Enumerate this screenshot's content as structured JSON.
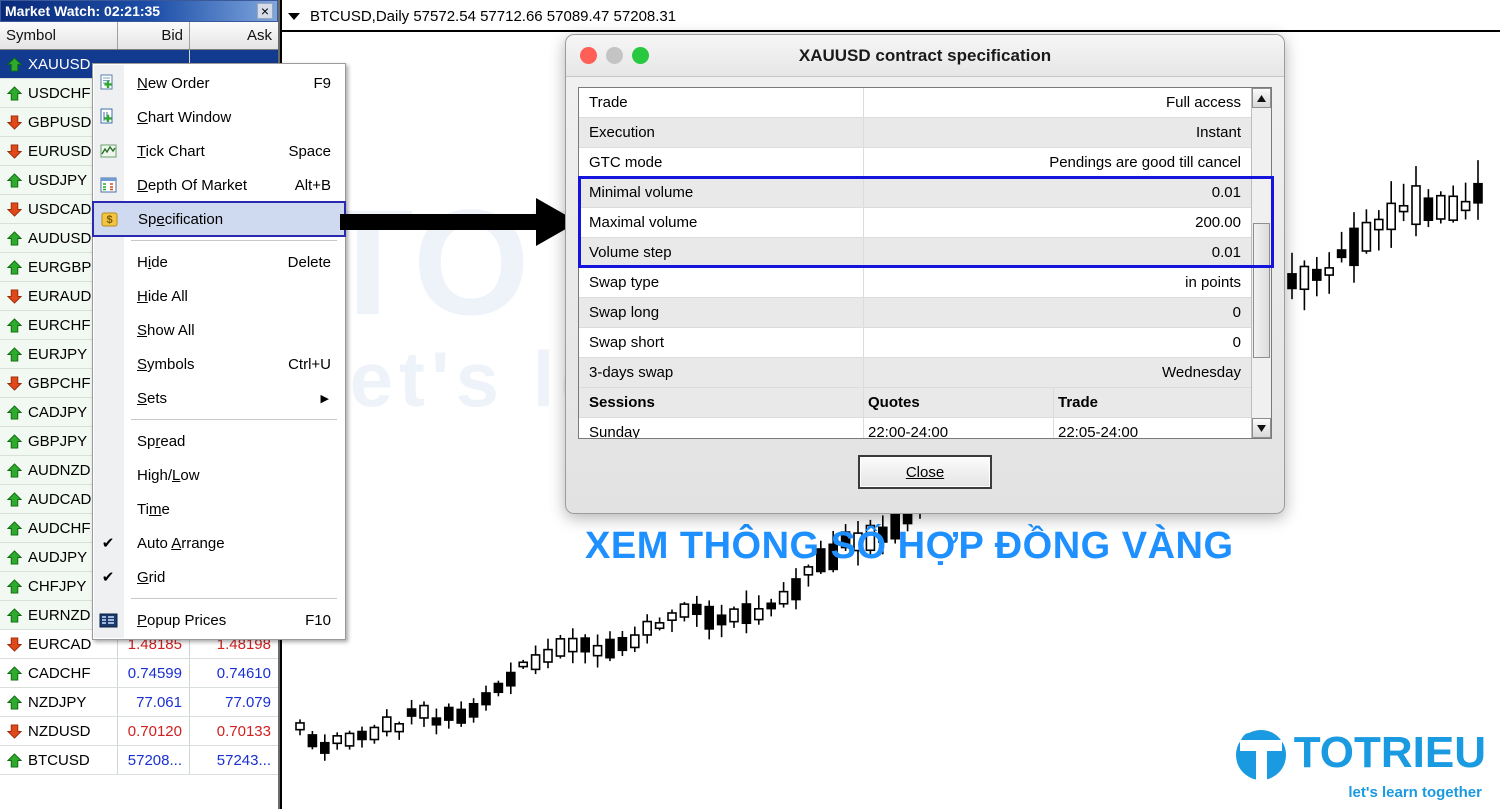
{
  "chart": {
    "symbol_line": "BTCUSD,Daily  57572.54 57712.66 57089.47 57208.31",
    "dropdown_icon": "caret-down-icon",
    "watermark_line1": "TOTRIEU",
    "watermark_line2": "let's learn together"
  },
  "market_watch": {
    "title": "Market Watch: 02:21:35",
    "close_label": "×",
    "columns": {
      "symbol": "Symbol",
      "bid": "Bid",
      "ask": "Ask"
    },
    "rows": [
      {
        "symbol": "XAUUSD",
        "dir": "up",
        "bid": "",
        "ask": "",
        "selected": true
      },
      {
        "symbol": "USDCHF",
        "dir": "up",
        "bid": "",
        "ask": ""
      },
      {
        "symbol": "GBPUSD",
        "dir": "down",
        "bid": "",
        "ask": ""
      },
      {
        "symbol": "EURUSD",
        "dir": "down",
        "bid": "",
        "ask": ""
      },
      {
        "symbol": "USDJPY",
        "dir": "up",
        "bid": "",
        "ask": ""
      },
      {
        "symbol": "USDCAD",
        "dir": "down",
        "bid": "",
        "ask": ""
      },
      {
        "symbol": "AUDUSD",
        "dir": "up",
        "bid": "",
        "ask": ""
      },
      {
        "symbol": "EURGBP",
        "dir": "up",
        "bid": "",
        "ask": ""
      },
      {
        "symbol": "EURAUD",
        "dir": "down",
        "bid": "",
        "ask": ""
      },
      {
        "symbol": "EURCHF",
        "dir": "up",
        "bid": "",
        "ask": ""
      },
      {
        "symbol": "EURJPY",
        "dir": "up",
        "bid": "",
        "ask": ""
      },
      {
        "symbol": "GBPCHF",
        "dir": "down",
        "bid": "",
        "ask": ""
      },
      {
        "symbol": "CADJPY",
        "dir": "up",
        "bid": "",
        "ask": ""
      },
      {
        "symbol": "GBPJPY",
        "dir": "up",
        "bid": "",
        "ask": ""
      },
      {
        "symbol": "AUDNZD",
        "dir": "up",
        "bid": "",
        "ask": ""
      },
      {
        "symbol": "AUDCAD",
        "dir": "up",
        "bid": "",
        "ask": ""
      },
      {
        "symbol": "AUDCHF",
        "dir": "up",
        "bid": "",
        "ask": ""
      },
      {
        "symbol": "AUDJPY",
        "dir": "up",
        "bid": "",
        "ask": ""
      },
      {
        "symbol": "CHFJPY",
        "dir": "up",
        "bid": "",
        "ask": ""
      },
      {
        "symbol": "EURNZD",
        "dir": "up",
        "bid": "",
        "ask": ""
      },
      {
        "symbol": "EURCAD",
        "dir": "down",
        "bid": "1.48185",
        "ask": "1.48198",
        "color": "down"
      },
      {
        "symbol": "CADCHF",
        "dir": "up",
        "bid": "0.74599",
        "ask": "0.74610",
        "color": "up"
      },
      {
        "symbol": "NZDJPY",
        "dir": "up",
        "bid": "77.061",
        "ask": "77.079",
        "color": "up"
      },
      {
        "symbol": "NZDUSD",
        "dir": "down",
        "bid": "0.70120",
        "ask": "0.70133",
        "color": "down"
      },
      {
        "symbol": "BTCUSD",
        "dir": "up",
        "bid": "57208...",
        "ask": "57243...",
        "color": "up"
      }
    ]
  },
  "context_menu": {
    "items": [
      {
        "label": "New Order",
        "accel": "F9",
        "icon": "new-order-icon",
        "type": "item"
      },
      {
        "label": "Chart Window",
        "accel": "",
        "icon": "chart-window-icon",
        "type": "item"
      },
      {
        "label": "Tick Chart",
        "accel": "Space",
        "icon": "tick-chart-icon",
        "type": "item"
      },
      {
        "label": "Depth Of Market",
        "accel": "Alt+B",
        "icon": "depth-market-icon",
        "type": "item"
      },
      {
        "label": "Specification",
        "accel": "",
        "icon": "specification-icon",
        "type": "item",
        "highlighted": true
      },
      {
        "type": "separator"
      },
      {
        "label": "Hide",
        "accel": "Delete",
        "type": "item"
      },
      {
        "label": "Hide All",
        "accel": "",
        "type": "item"
      },
      {
        "label": "Show All",
        "accel": "",
        "type": "item"
      },
      {
        "label": "Symbols",
        "accel": "Ctrl+U",
        "type": "item"
      },
      {
        "label": "Sets",
        "accel": "",
        "type": "item",
        "submenu": true
      },
      {
        "type": "separator"
      },
      {
        "label": "Spread",
        "accel": "",
        "type": "item"
      },
      {
        "label": "High/Low",
        "accel": "",
        "type": "item"
      },
      {
        "label": "Time",
        "accel": "",
        "type": "item"
      },
      {
        "label": "Auto Arrange",
        "accel": "",
        "type": "item",
        "checked": true
      },
      {
        "label": "Grid",
        "accel": "",
        "type": "item",
        "checked": true
      },
      {
        "type": "separator"
      },
      {
        "label": "Popup Prices",
        "accel": "F10",
        "icon": "popup-prices-icon",
        "type": "item"
      }
    ]
  },
  "spec_dialog": {
    "title": "XAUUSD contract specification",
    "traffic_lights": {
      "close": "#ff5f57",
      "minimize": "#c4c4c4",
      "maximize": "#28c840"
    },
    "rows": [
      {
        "key": "Trade",
        "value": "Full access"
      },
      {
        "key": "Execution",
        "value": "Instant"
      },
      {
        "key": "GTC mode",
        "value": "Pendings are good till cancel"
      },
      {
        "key": "Minimal volume",
        "value": "0.01"
      },
      {
        "key": "Maximal volume",
        "value": "200.00"
      },
      {
        "key": "Volume step",
        "value": "0.01"
      },
      {
        "key": "Swap type",
        "value": "in points"
      },
      {
        "key": "Swap long",
        "value": "0"
      },
      {
        "key": "Swap short",
        "value": "0"
      },
      {
        "key": "3-days swap",
        "value": "Wednesday"
      }
    ],
    "sessions_header": {
      "col1": "Sessions",
      "col2": "Quotes",
      "col3": "Trade"
    },
    "sessions": [
      {
        "day": "Sunday",
        "quotes": "22:00-24:00",
        "trade": "22:05-24:00"
      }
    ],
    "close_label": "Close",
    "highlight_color": "#1414dc",
    "scroll_up_icon": "triangle-up-icon",
    "scroll_down_icon": "triangle-down-icon"
  },
  "caption": {
    "text": "XEM THÔNG SỐ HỢP ĐỒNG VÀNG",
    "color": "#1e90ff"
  },
  "logo": {
    "name": "TOTRIEU",
    "tagline": "let's learn together",
    "color": "#1a9ae0"
  }
}
